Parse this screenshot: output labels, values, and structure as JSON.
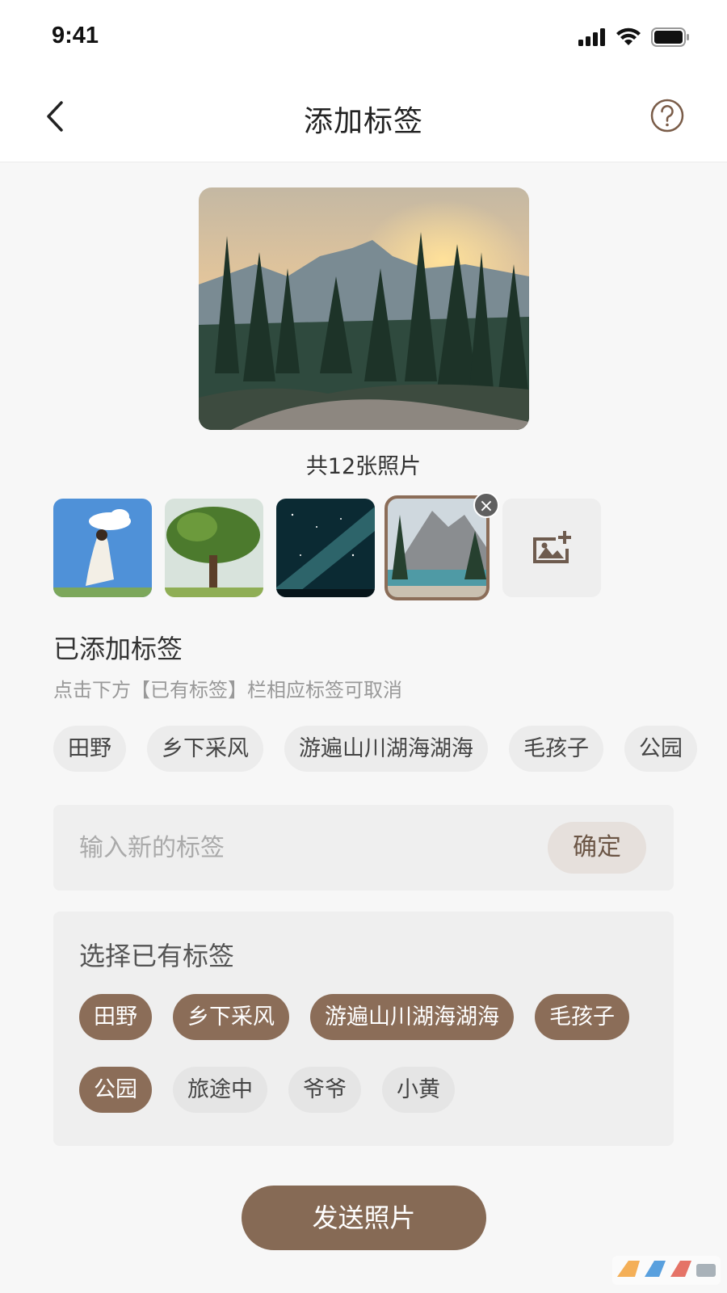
{
  "status_bar": {
    "time": "9:41"
  },
  "header": {
    "title": "添加标签"
  },
  "main_photo": {
    "count_label": "共12张照片"
  },
  "thumbnails": [
    {
      "subject": "girl-with-cloud"
    },
    {
      "subject": "tree"
    },
    {
      "subject": "milky-way"
    },
    {
      "subject": "lake-mountains",
      "selected": true
    }
  ],
  "added_section": {
    "title": "已添加标签",
    "hint": "点击下方【已有标签】栏相应标签可取消",
    "tags": [
      "田野",
      "乡下采风",
      "游遍山川湖海湖海",
      "毛孩子",
      "公园"
    ]
  },
  "new_tag_input": {
    "placeholder": "输入新的标签",
    "value": "",
    "confirm_label": "确定"
  },
  "existing_section": {
    "title": "选择已有标签",
    "row1": [
      {
        "label": "田野",
        "active": true
      },
      {
        "label": "乡下采风",
        "active": true
      },
      {
        "label": "游遍山川湖海湖海",
        "active": true
      },
      {
        "label": "毛孩子",
        "active": true
      }
    ],
    "row2": [
      {
        "label": "公园",
        "active": true
      },
      {
        "label": "旅途中",
        "active": false
      },
      {
        "label": "爷爷",
        "active": false
      },
      {
        "label": "小黄",
        "active": false
      }
    ]
  },
  "send_button": {
    "label": "发送照片"
  },
  "colors": {
    "accent": "#8b6d58",
    "tag_bg": "#ececec",
    "page_bg": "#f7f7f7"
  },
  "icons": [
    "back-icon",
    "help-icon",
    "signal-icon",
    "wifi-icon",
    "battery-icon",
    "close-icon",
    "add-image-icon"
  ]
}
